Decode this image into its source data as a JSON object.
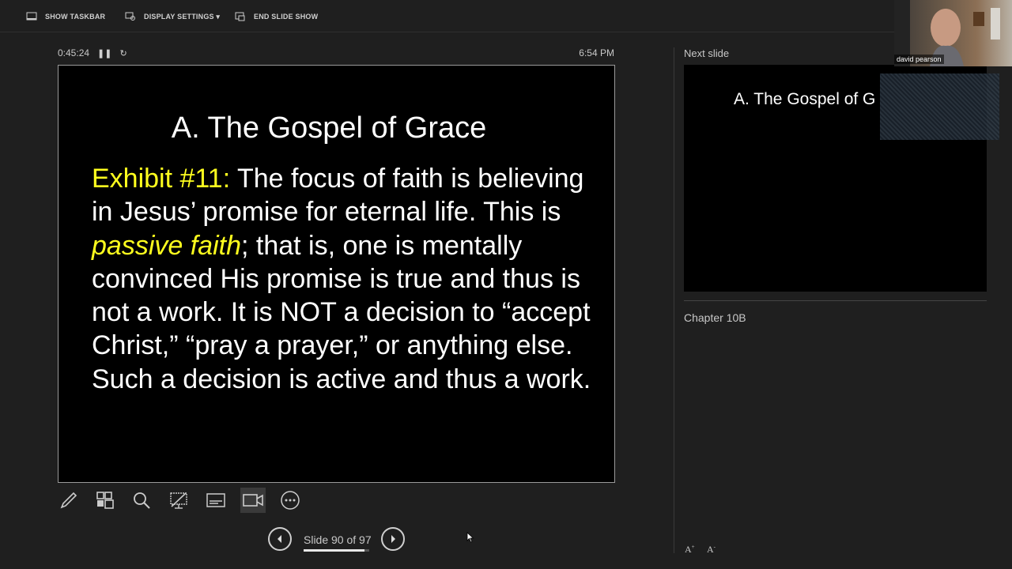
{
  "toolbar": {
    "show_taskbar": "SHOW TASKBAR",
    "display_settings": "DISPLAY SETTINGS ▾",
    "end_slide_show": "END SLIDE SHOW"
  },
  "timer": {
    "elapsed": "0:45:24",
    "pause_icon": "pause-icon",
    "restart_icon": "restart-icon"
  },
  "clock": "6:54 PM",
  "current_slide": {
    "title": "A. The Gospel of Grace",
    "exhibit_label": "Exhibit #11:",
    "text_1": " The focus of faith is believing in Jesus’ promise for eternal life. This is ",
    "emphasis": "passive faith",
    "text_2": "; that is, one is mentally convinced His promise is true and thus is not a work. It is NOT a decision to “accept Christ,” “pray a prayer,” or anything else. Such a decision is active and thus a work.",
    "highlight_color": "#ffff1e"
  },
  "tools": [
    "pen-icon",
    "see-all-slides-icon",
    "zoom-icon",
    "black-screen-icon",
    "subtitles-icon",
    "camera-icon",
    "more-options-icon"
  ],
  "navigation": {
    "slide_label": "Slide 90 of 97",
    "current": 90,
    "total": 97
  },
  "next_slide": {
    "label": "Next slide",
    "title": "A. The Gospel of G"
  },
  "notes": "Chapter 10B",
  "webcam": {
    "name": "david pearson"
  },
  "font_controls": {
    "increase": "A",
    "decrease": "A"
  }
}
